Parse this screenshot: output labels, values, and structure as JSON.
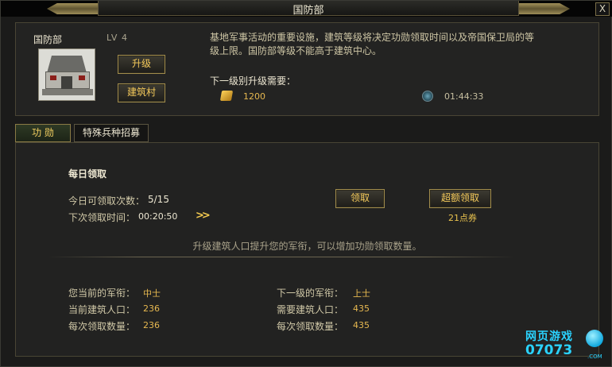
{
  "window": {
    "title": "国防部",
    "close_label": "X"
  },
  "building": {
    "name": "国防部",
    "level": "LV  4",
    "upgrade_label": "升级",
    "materials_label": "建筑村",
    "description": "基地军事活动的重要设施，建筑等级将决定功勋领取时间以及帝国保卫局的等级上限。国防部等级不能高于建筑中心。",
    "next_level_label": "下一级别升级需要：",
    "cost": "1200",
    "time": "01:44:33"
  },
  "tabs": {
    "merit": "功  勋",
    "recruit": "特殊兵种招募"
  },
  "daily": {
    "title": "每日领取",
    "claims_label": "今日可领取次数：",
    "claims_value": "5/15",
    "next_label": "下次领取时间：",
    "next_value": "00:20:50",
    "arrows": ">>",
    "claim_button": "领取",
    "extra_button": "超额领取",
    "voucher": "21点券",
    "hint": "升级建筑人口提升您的军衔，可以增加功勋领取数量。"
  },
  "current": {
    "rank_label": "您当前的军衔：",
    "rank_value": "中士",
    "pop_label": "当前建筑人口：",
    "pop_value": "236",
    "amount_label": "每次领取数量：",
    "amount_value": "236"
  },
  "next": {
    "rank_label": "下一级的军衔：",
    "rank_value": "上士",
    "pop_label": "需要建筑人口：",
    "pop_value": "435",
    "amount_label": "每次领取数量：",
    "amount_value": "435"
  },
  "watermark": {
    "line1": "网页游戏",
    "line2": "07073",
    "com": ".COM"
  },
  "colors": {
    "gold_text": "#f4c95a",
    "panel_bg": "#232322",
    "border": "#494534"
  }
}
